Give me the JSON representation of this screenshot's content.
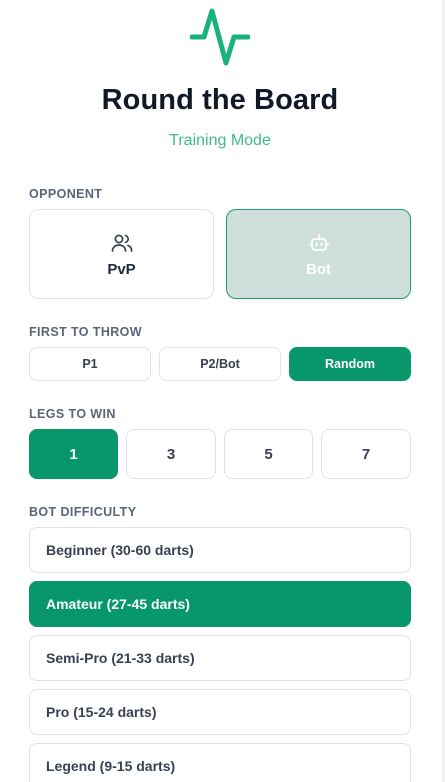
{
  "header": {
    "title": "Round the Board",
    "subtitle": "Training Mode",
    "logo_icon": "pulse-icon"
  },
  "colors": {
    "accent": "#07976a",
    "accent_light": "#3dbd86",
    "selected_soft": "#cfdfdb"
  },
  "opponent": {
    "label": "OPPONENT",
    "options": [
      {
        "label": "PvP",
        "icon": "users-icon",
        "selected": false
      },
      {
        "label": "Bot",
        "icon": "bot-icon",
        "selected": true
      }
    ]
  },
  "first_to_throw": {
    "label": "FIRST TO THROW",
    "options": [
      {
        "label": "P1",
        "selected": false
      },
      {
        "label": "P2/Bot",
        "selected": false
      },
      {
        "label": "Random",
        "selected": true
      }
    ]
  },
  "legs_to_win": {
    "label": "LEGS TO WIN",
    "options": [
      {
        "label": "1",
        "selected": true
      },
      {
        "label": "3",
        "selected": false
      },
      {
        "label": "5",
        "selected": false
      },
      {
        "label": "7",
        "selected": false
      }
    ]
  },
  "bot_difficulty": {
    "label": "BOT DIFFICULTY",
    "options": [
      {
        "label": "Beginner (30-60 darts)",
        "selected": false
      },
      {
        "label": "Amateur (27-45 darts)",
        "selected": true
      },
      {
        "label": "Semi-Pro (21-33 darts)",
        "selected": false
      },
      {
        "label": "Pro (15-24 darts)",
        "selected": false
      },
      {
        "label": "Legend (9-15 darts)",
        "selected": false
      }
    ]
  }
}
